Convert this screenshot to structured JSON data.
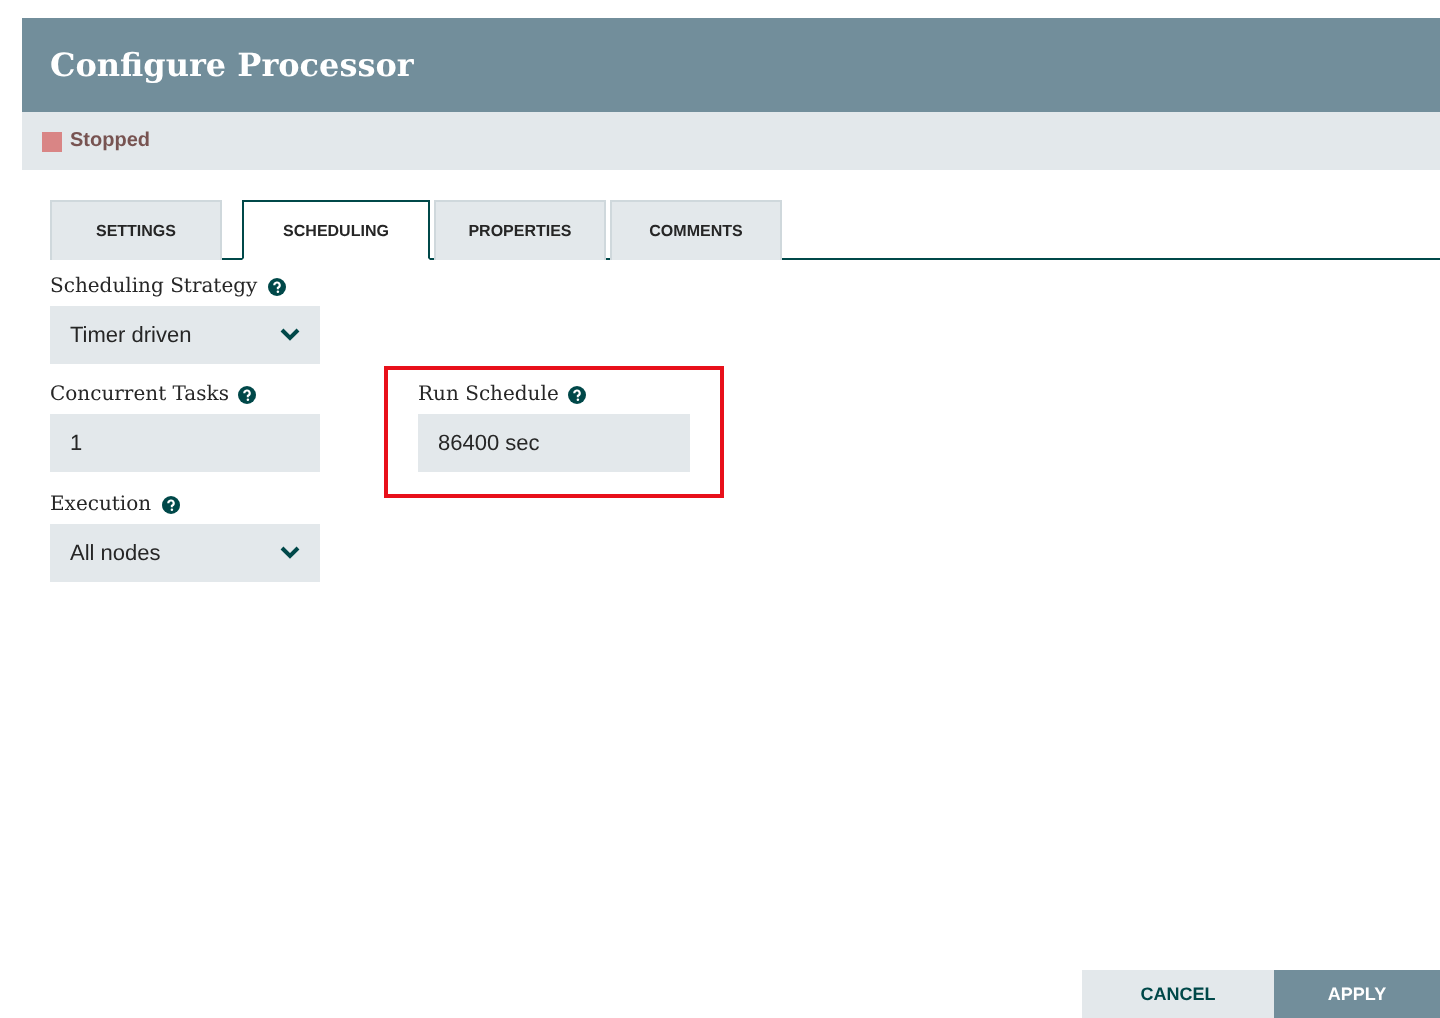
{
  "window": {
    "title": "Configure Processor"
  },
  "status": {
    "label": "Stopped",
    "color": "#d98585"
  },
  "tabs": [
    {
      "label": "SETTINGS",
      "selected": false
    },
    {
      "label": "SCHEDULING",
      "selected": true
    },
    {
      "label": "PROPERTIES",
      "selected": false
    },
    {
      "label": "COMMENTS",
      "selected": false
    }
  ],
  "fields": [
    {
      "label": "Scheduling Strategy",
      "kind": "select",
      "value": "Timer driven",
      "highlighted": false
    },
    {
      "label": "Concurrent Tasks",
      "kind": "input",
      "value": "1",
      "highlighted": false
    },
    {
      "label": "Run Schedule",
      "kind": "input",
      "value": "86400 sec",
      "highlighted": true
    },
    {
      "label": "Execution",
      "kind": "select",
      "value": "All nodes",
      "highlighted": false
    }
  ],
  "buttons": [
    {
      "label": "CANCEL",
      "kind": "secondary"
    },
    {
      "label": "APPLY",
      "kind": "primary"
    }
  ]
}
